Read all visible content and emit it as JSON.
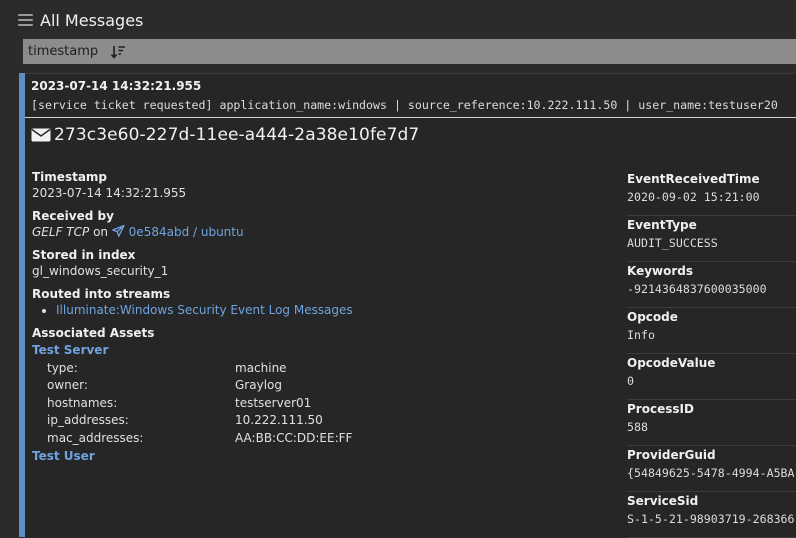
{
  "header": {
    "title": "All Messages",
    "menu_icon": "hamburger-menu-icon"
  },
  "sortbar": {
    "field": "timestamp",
    "sort_icon": "sort-descending-icon"
  },
  "message": {
    "timestamp": "2023-07-14 14:32:21.955",
    "summary": "[service ticket requested] application_name:windows | source_reference:10.222.111.50 | user_name:testuser20",
    "id": "273c3e60-227d-11ee-a444-2a38e10fe7d7",
    "id_icon": "envelope-icon",
    "accent_color": "#5d8fc4",
    "details": {
      "timestamp_label": "Timestamp",
      "timestamp_value": "2023-07-14 14:32:21.955",
      "received_label": "Received by",
      "received_input": "GELF TCP",
      "received_on": "on",
      "received_node_icon": "paper-plane-icon",
      "received_node": "0e584abd / ubuntu",
      "index_label": "Stored in index",
      "index_value": "gl_windows_security_1",
      "streams_label": "Routed into streams",
      "streams": [
        "Illuminate:Windows Security Event Log Messages"
      ],
      "assets_label": "Associated Assets",
      "assets": [
        {
          "name": "Test Server",
          "fields": [
            {
              "key": "type:",
              "value": "machine"
            },
            {
              "key": "owner:",
              "value": "Graylog"
            },
            {
              "key": "hostnames:",
              "value": "testserver01"
            },
            {
              "key": "ip_addresses:",
              "value": "10.222.111.50"
            },
            {
              "key": "mac_addresses:",
              "value": "AA:BB:CC:DD:EE:FF"
            }
          ]
        },
        {
          "name": "Test User"
        }
      ]
    },
    "fields": [
      {
        "name": "EventReceivedTime",
        "value": "2020-09-02 15:21:00"
      },
      {
        "name": "EventType",
        "value": "AUDIT_SUCCESS"
      },
      {
        "name": "Keywords",
        "value": "-9214364837600035000"
      },
      {
        "name": "Opcode",
        "value": "Info"
      },
      {
        "name": "OpcodeValue",
        "value": "0"
      },
      {
        "name": "ProcessID",
        "value": "588"
      },
      {
        "name": "ProviderGuid",
        "value": "{54849625-5478-4994-A5BA"
      },
      {
        "name": "ServiceSid",
        "value": "S-1-5-21-98903719-268366"
      }
    ]
  }
}
